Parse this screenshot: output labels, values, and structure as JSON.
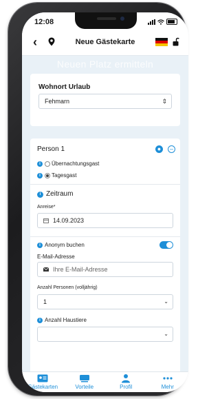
{
  "status_bar": {
    "time": "12:08"
  },
  "nav": {
    "title": "Neue Gästekarte"
  },
  "banner_ghost_text": "Neuen Platz ermitteln",
  "residence": {
    "label": "Wohnort Urlaub",
    "value": "Fehmarn",
    "control_glyph": "⌄"
  },
  "person": {
    "title": "Person 1",
    "options": [
      {
        "label": "Übernachtungsgast",
        "selected": false
      },
      {
        "label": "Tagesgast",
        "selected": true
      }
    ]
  },
  "period": {
    "title": "Zeitraum",
    "arrival_label": "Anreise*",
    "arrival_value": "14.09.2023"
  },
  "anonymous": {
    "label": "Anonym buchen",
    "enabled": true
  },
  "email": {
    "label": "E-Mail-Adresse",
    "placeholder": "Ihre E-Mail-Adresse"
  },
  "persons_count": {
    "label": "Anzahl Personen (volljährig)",
    "value": "1"
  },
  "pets": {
    "label": "Anzahl Haustiere"
  },
  "tabs": [
    {
      "label": "Gästekarten",
      "icon": "id-card-icon"
    },
    {
      "label": "Vorteile",
      "icon": "ticket-icon"
    },
    {
      "label": "Profil",
      "icon": "person-icon"
    },
    {
      "label": "Mehr",
      "icon": "more-dots-icon"
    }
  ],
  "colors": {
    "accent": "#1e8fd8",
    "background": "#e9f1f7"
  }
}
